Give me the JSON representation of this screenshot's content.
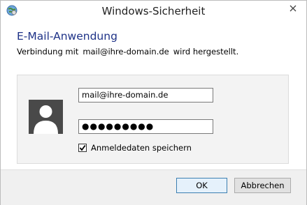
{
  "window": {
    "title": "Windows-Sicherheit",
    "close_icon": "close-icon",
    "app_icon": "globe-icon"
  },
  "header": {
    "app_name": "E-Mail-Anwendung",
    "desc_prefix": "Verbindung mit",
    "desc_account": "mail@ihre-domain.de",
    "desc_suffix": "wird hergestellt."
  },
  "credentials": {
    "avatar_icon": "user-avatar-icon",
    "username_value": "mail@ihre-domain.de",
    "password_value": "●●●●●●●●●",
    "remember_label": "Anmeldedaten speichern",
    "remember_checked": true
  },
  "footer": {
    "ok_label": "OK",
    "cancel_label": "Abbrechen"
  },
  "colors": {
    "title_blue": "#1e3287",
    "ok_border": "#3c7fb1"
  }
}
